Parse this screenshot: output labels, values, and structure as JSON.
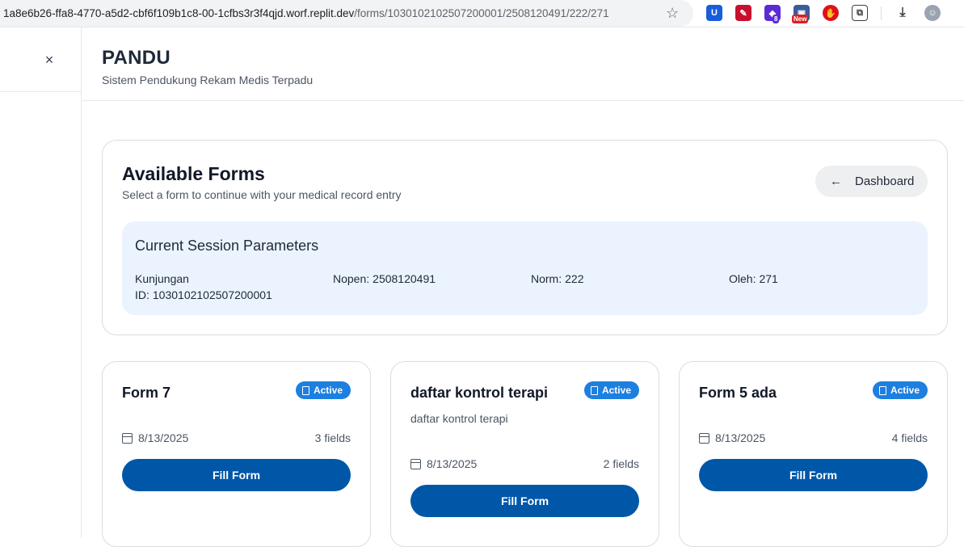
{
  "browser": {
    "url_host": "1a8e6b26-ffa8-4770-a5d2-cbf6f109b1c8-00-1cfbs3r3f4qjd.worf.replit.dev",
    "url_path": "/forms/1030102102507200001/2508120491/222/271",
    "ext_badge_count": "8",
    "ext_badge_new": "New"
  },
  "sidebar": {
    "close_icon": "×"
  },
  "header": {
    "title": "PANDU",
    "subtitle": "Sistem Pendukung Rekam Medis Terpadu"
  },
  "panel": {
    "title": "Available Forms",
    "subtitle": "Select a form to continue with your medical record entry",
    "dashboard_label": "Dashboard",
    "session": {
      "title": "Current Session Parameters",
      "params": [
        {
          "label": "Kunjungan ID:",
          "value": "1030102102507200001"
        },
        {
          "label": "Nopen:",
          "value": "2508120491"
        },
        {
          "label": "Norm:",
          "value": "222"
        },
        {
          "label": "Oleh:",
          "value": "271"
        }
      ]
    }
  },
  "forms": [
    {
      "title": "Form 7",
      "status": "Active",
      "description": "",
      "date": "8/13/2025",
      "fields": "3 fields",
      "button": "Fill Form"
    },
    {
      "title": "daftar kontrol terapi",
      "status": "Active",
      "description": "daftar kontrol terapi",
      "date": "8/13/2025",
      "fields": "2 fields",
      "button": "Fill Form"
    },
    {
      "title": "Form 5 ada",
      "status": "Active",
      "description": "",
      "date": "8/13/2025",
      "fields": "4 fields",
      "button": "Fill Form"
    }
  ],
  "colors": {
    "primary": "#0057a8",
    "badge": "#1d7fe0",
    "session_bg": "#ebf3fe"
  }
}
